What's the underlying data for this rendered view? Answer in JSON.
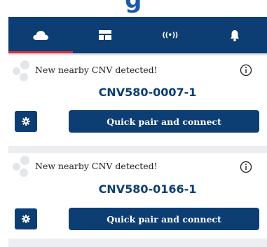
{
  "header": {
    "title_fragment": "g"
  },
  "tabs": [
    {
      "name": "cloud",
      "icon": "cloud-icon",
      "active": true
    },
    {
      "name": "dashboard",
      "icon": "panel-icon",
      "active": false
    },
    {
      "name": "signal",
      "icon": "signal-icon",
      "icon_text": "((•))",
      "active": false
    },
    {
      "name": "notifications",
      "icon": "bell-icon",
      "active": false
    }
  ],
  "devices": [
    {
      "message": "New nearby CNV detected!",
      "device_id": "CNV580-0007-1",
      "pair_label": "Quick pair and connect"
    },
    {
      "message": "New nearby CNV detected!",
      "device_id": "CNV580-0166-1",
      "pair_label": "Quick pair and connect"
    }
  ],
  "colors": {
    "primary": "#0d3e73",
    "accent": "#d9303a",
    "title": "#1c5aa8"
  }
}
